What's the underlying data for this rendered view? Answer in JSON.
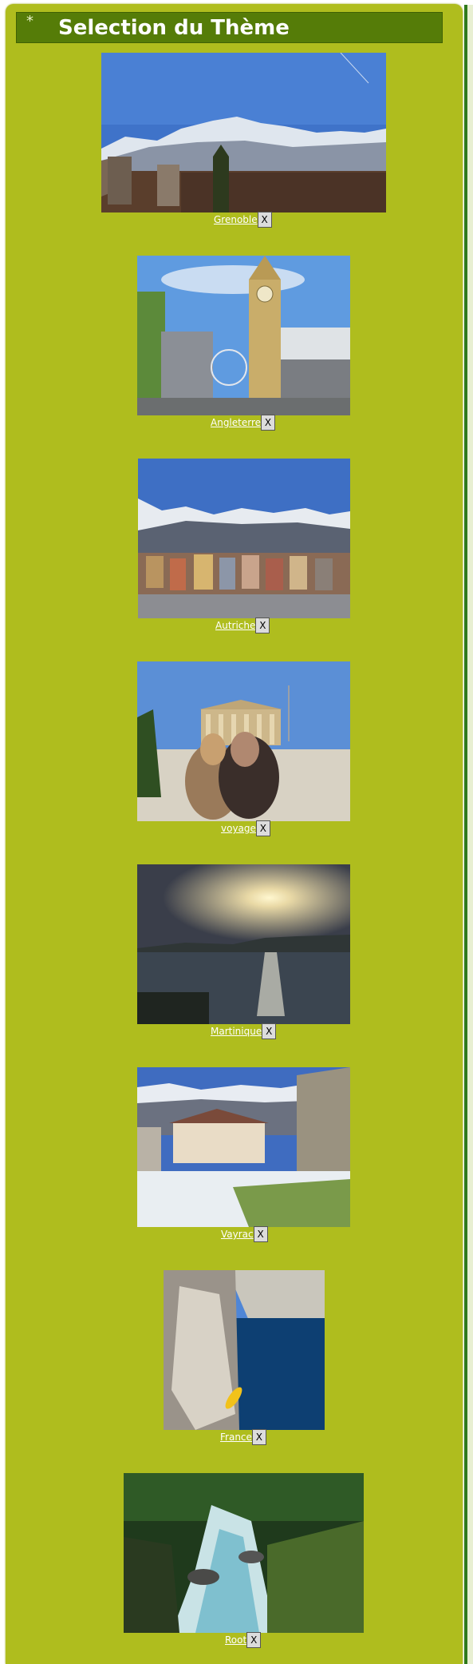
{
  "header": {
    "title": "Selection du Thème",
    "marker": "*"
  },
  "themes": [
    {
      "name": "Grenoble",
      "image": "alpine mountains with castle ruins",
      "delete_label": "X"
    },
    {
      "name": "Angleterre",
      "image": "Big Ben clock tower London",
      "delete_label": "X"
    },
    {
      "name": "Autriche",
      "image": "Innsbruck houses below snowy mountains",
      "delete_label": "X"
    },
    {
      "name": "voyage",
      "image": "Parthenon Athens with blurred people",
      "delete_label": "X"
    },
    {
      "name": "Martinique",
      "image": "sunset over the sea",
      "delete_label": "X"
    },
    {
      "name": "Vayrac",
      "image": "village house with snowy mountains",
      "delete_label": "X"
    },
    {
      "name": "France",
      "image": "gorge with blue water and kayak",
      "delete_label": "X"
    },
    {
      "name": "Root",
      "image": "mountain river through forest",
      "delete_label": "X"
    }
  ],
  "colors": {
    "page_bg": "#afbd1e",
    "title_bg": "#557c08",
    "title_text": "#ffffff",
    "link": "#ffffff"
  }
}
